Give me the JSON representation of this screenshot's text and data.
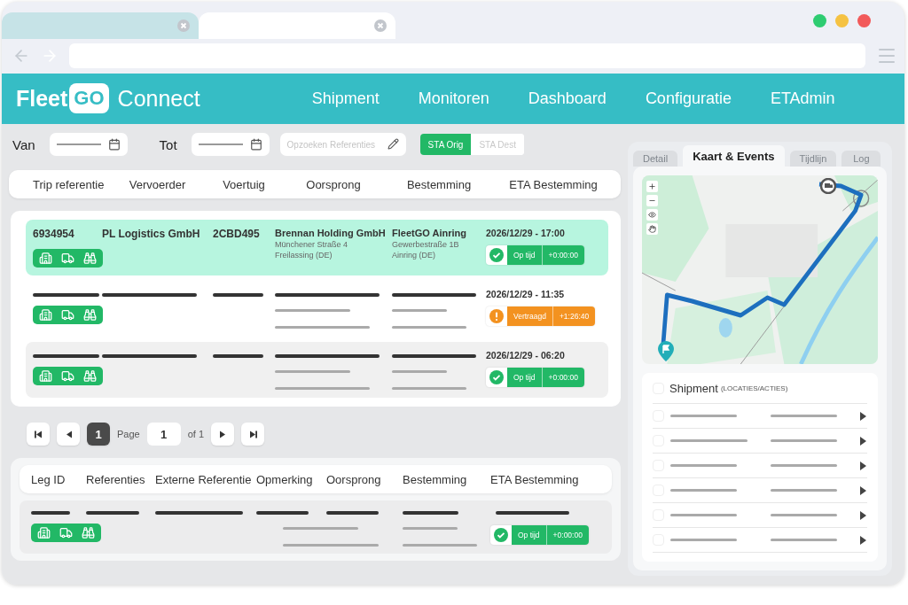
{
  "browser": {
    "tabs": [
      {
        "selected": false
      },
      {
        "selected": true
      }
    ]
  },
  "logo": {
    "word": "Fleet",
    "badge": "GO",
    "product": "Connect"
  },
  "nav": [
    "Shipment",
    "Monitoren",
    "Dashboard",
    "Configuratie",
    "ETAdmin"
  ],
  "filters": {
    "from_label": "Van",
    "to_label": "Tot",
    "search": {
      "placeholder": "Opzoeken Referenties"
    },
    "toggle": [
      {
        "label": "STA Orig",
        "selected": true
      },
      {
        "label": "STA Dest",
        "selected": false
      }
    ]
  },
  "trips": {
    "columns": [
      "Trip referentie",
      "Vervoerder",
      "Voertuig",
      "Oorsprong",
      "Bestemming",
      "ETA Bestemming"
    ],
    "rows": [
      {
        "kind": "detail",
        "selected": true,
        "id": "6934954",
        "carrier": "PL Logistics GmbH",
        "vehicle": "2CBD495",
        "origin": {
          "name": "Brennan Holding GmbH",
          "address": [
            "Münchener Straße 4",
            "Freilassing (DE)"
          ]
        },
        "destination": {
          "name": "FleetGO Ainring",
          "address": [
            "Gewerbestraße 1B",
            "Ainring (DE)"
          ]
        },
        "eta": "2026/12/29 - 17:00",
        "status": {
          "kind": "on_time",
          "label": "Op tijd",
          "delta": "+0:00:00"
        }
      },
      {
        "kind": "skeleton",
        "selected": false,
        "eta": "2026/12/29 - 11:35",
        "status": {
          "kind": "late",
          "label": "Vertraagd",
          "delta": "+1:26:40"
        }
      },
      {
        "kind": "skeleton",
        "selected": false,
        "eta": "2026/12/29 - 06:20",
        "status": {
          "kind": "on_time",
          "label": "Op tijd",
          "delta": "+0:00:00"
        }
      }
    ]
  },
  "pagination": {
    "current": "1",
    "page_label": "Page",
    "page_input": "1",
    "of_label": "of 1"
  },
  "legs": {
    "columns": [
      "Leg ID",
      "Referenties",
      "Externe Referentie",
      "Opmerking",
      "Oorsprong",
      "Bestemming",
      "ETA Bestemming"
    ],
    "rows": [
      {
        "kind": "skeleton",
        "status": {
          "kind": "on_time",
          "label": "Op tijd",
          "delta": "+0:00:00"
        }
      }
    ]
  },
  "side_tabs": [
    {
      "label": "Detail",
      "selected": false
    },
    {
      "label": "Kaart & Events",
      "selected": true
    },
    {
      "label": "Tijdlijn",
      "selected": false
    },
    {
      "label": "Log",
      "selected": false
    }
  ],
  "map": {
    "kind": "picture"
  },
  "shipment": {
    "checked": false,
    "title": "Shipment",
    "subtitle": "(LOCATIES/ACTIES)",
    "rows": [
      {
        "checked": false
      },
      {
        "checked": false
      },
      {
        "checked": false
      },
      {
        "checked": false
      },
      {
        "checked": false
      },
      {
        "checked": false
      }
    ]
  }
}
